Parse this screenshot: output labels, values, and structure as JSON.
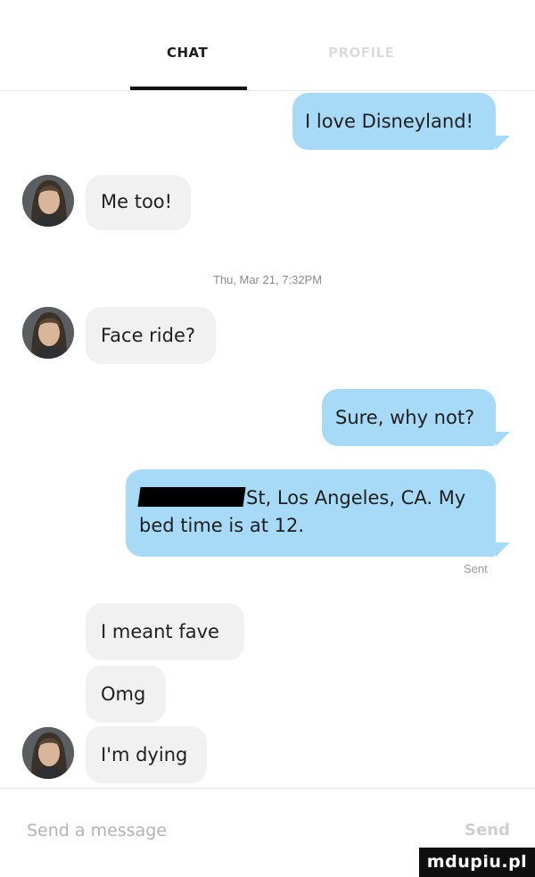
{
  "tabs": {
    "chat": "CHAT",
    "profile": "PROFILE"
  },
  "messages": [
    {
      "dir": "out",
      "text": "I love Disneyland!"
    },
    {
      "dir": "in",
      "text": "Me too!"
    },
    {
      "dir": "in",
      "text": "Face ride?"
    },
    {
      "dir": "out",
      "text": "Sure, why not?"
    },
    {
      "dir": "out",
      "line1": "St, Los Angeles, CA. My",
      "line2": "bed time is at 12."
    },
    {
      "dir": "in",
      "text": "I meant fave"
    },
    {
      "dir": "in",
      "text": "Omg"
    },
    {
      "dir": "in",
      "text": "I'm dying"
    }
  ],
  "timestamp": "Thu, Mar 21, 7:32PM",
  "sent_status": "Sent",
  "composer": {
    "placeholder": "Send a message",
    "send_label": "Send"
  },
  "watermark": "mdupiu.pl",
  "colors": {
    "outgoing": "#a6daf7",
    "incoming": "#f1f1f1",
    "tab_active": "#1e1e1e",
    "tab_inactive": "#dcdcdc"
  }
}
